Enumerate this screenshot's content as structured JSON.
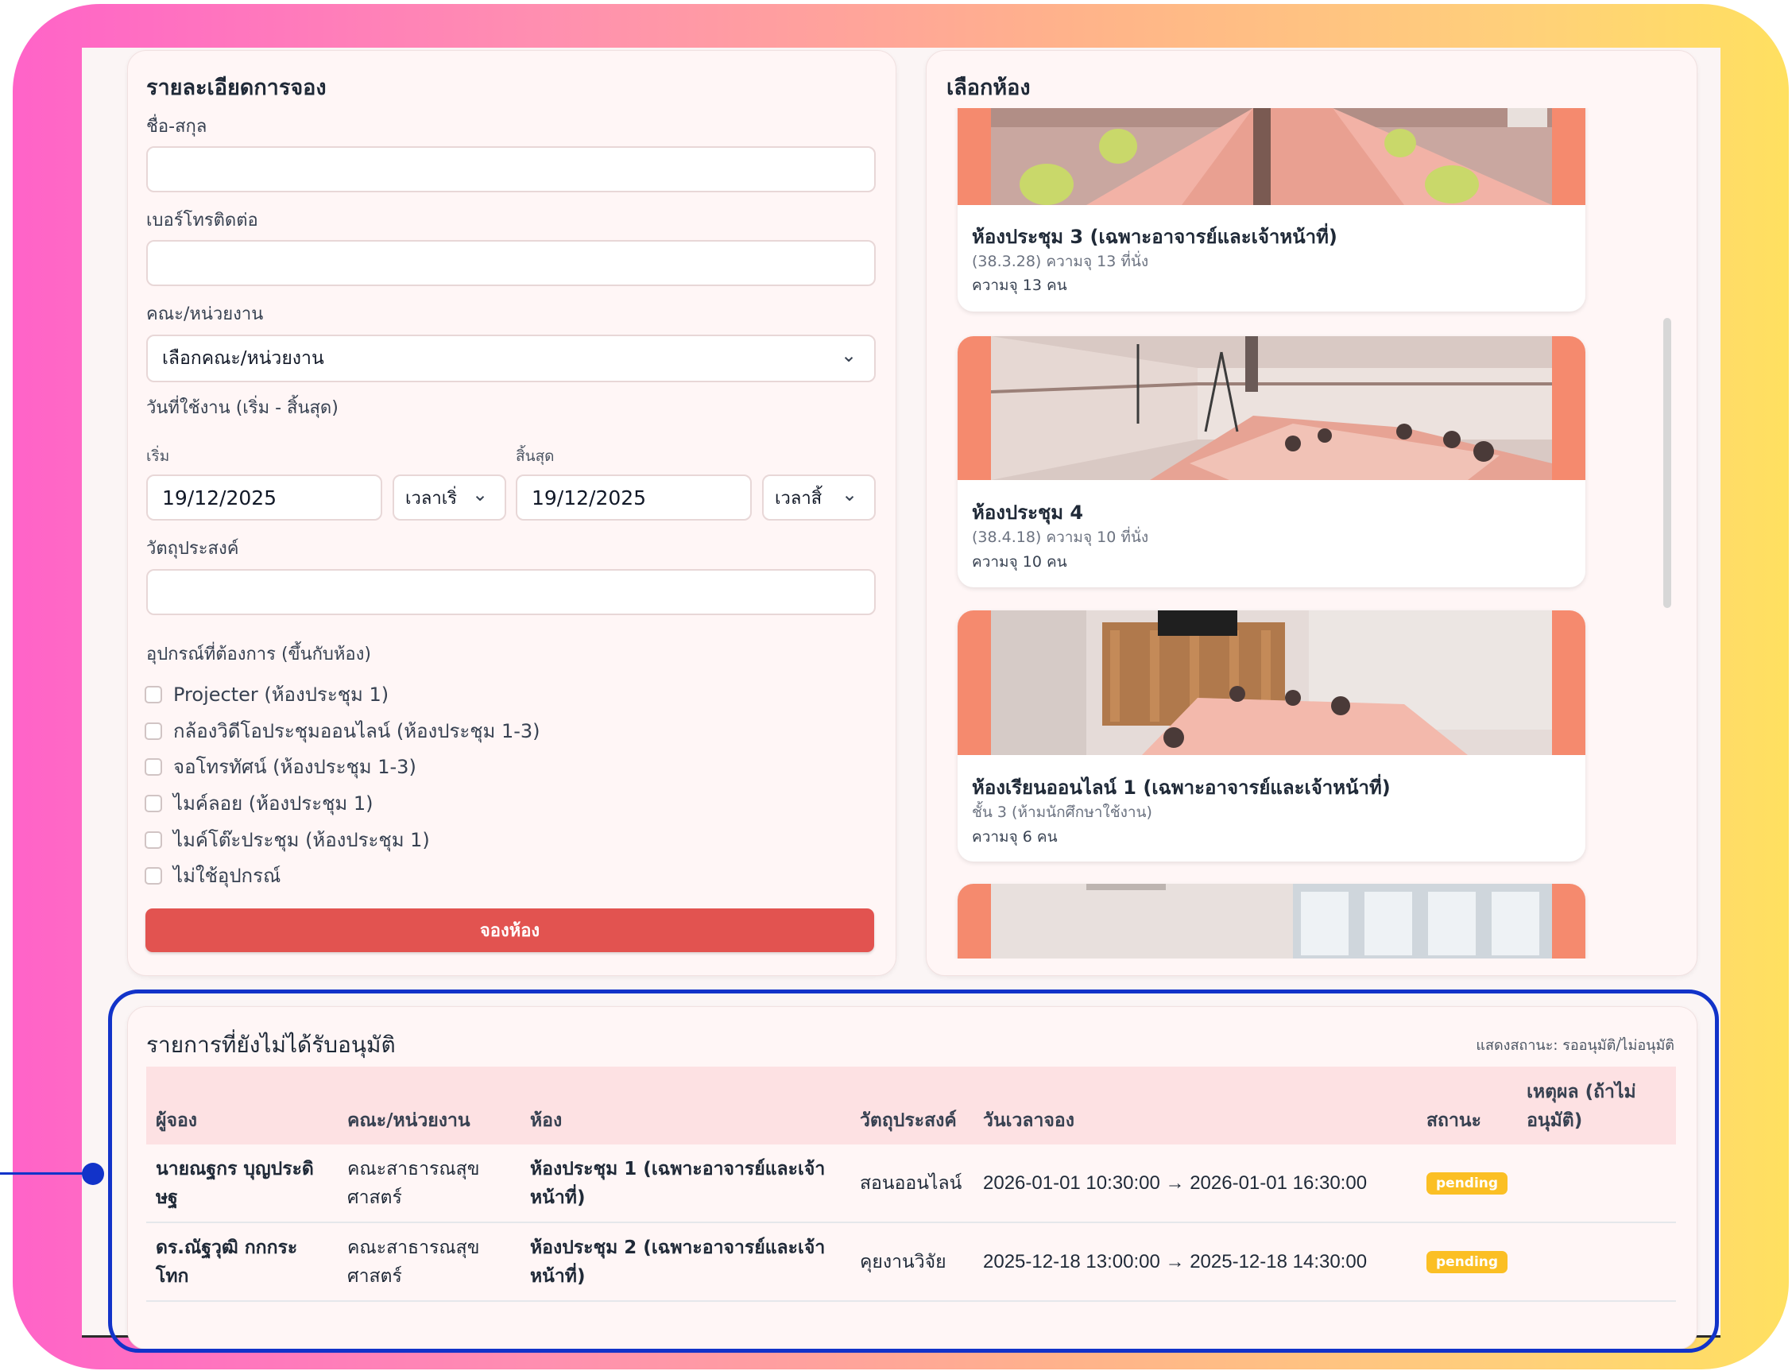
{
  "booking_form": {
    "title": "รายละเอียดการจอง",
    "name_label": "ชื่อ-สกุล",
    "name_value": "",
    "phone_label": "เบอร์โทรติดต่อ",
    "phone_value": "",
    "faculty_label": "คณะ/หน่วยงาน",
    "faculty_selected": "เลือกคณะ/หน่วยงาน",
    "date_range_label": "วันที่ใช้งาน (เริ่ม - สิ้นสุด)",
    "start_label": "เริ่ม",
    "start_date": "19/12/2025",
    "start_time": "เวลาเริ่",
    "end_label": "สิ้นสุด",
    "end_date": "19/12/2025",
    "end_time": "เวลาสิ้",
    "purpose_label": "วัตถุประสงค์",
    "purpose_value": "",
    "equipment_label": "อุปกรณ์ที่ต้องการ (ขึ้นกับห้อง)",
    "equipment": [
      "Projecter (ห้องประชุม 1)",
      "กล้องวิดีโอประชุมออนไลน์ (ห้องประชุม 1-3)",
      "จอโทรทัศน์ (ห้องประชุม 1-3)",
      "ไมค์ลอย (ห้องประชุม 1)",
      "ไมค์โต๊ะประชุม (ห้องประชุม 1)",
      "ไม่ใช้อุปกรณ์"
    ],
    "submit_label": "จองห้อง"
  },
  "room_picker": {
    "title": "เลือกห้อง",
    "rooms": [
      {
        "name": "ห้องประชุม 3 (เฉพาะอาจารย์และเจ้าหน้าที่)",
        "sub": "(38.3.28) ความจุ 13 ที่นั่ง",
        "capacity": "ความจุ 13 คน"
      },
      {
        "name": "ห้องประชุม 4",
        "sub": "(38.4.18) ความจุ 10 ที่นั่ง",
        "capacity": "ความจุ 10 คน"
      },
      {
        "name": "ห้องเรียนออนไลน์ 1 (เฉพาะอาจารย์และเจ้าหน้าที่)",
        "sub": "ชั้น 3 (ห้ามนักศึกษาใช้งาน)",
        "capacity": "ความจุ 6 คน"
      }
    ]
  },
  "pending": {
    "title": "รายการที่ยังไม่ได้รับอนุมัติ",
    "status_note": "แสดงสถานะ: รออนุมัติ/ไม่อนุมัติ",
    "columns": {
      "booker": "ผู้จอง",
      "faculty": "คณะ/หน่วยงาน",
      "room": "ห้อง",
      "purpose": "วัตถุประสงค์",
      "datetime": "วันเวลาจอง",
      "status": "สถานะ",
      "reason": "เหตุผล (ถ้าไม่อนุมัติ)"
    },
    "rows": [
      {
        "booker": "นายณฐกร บุญประดิษฐ",
        "faculty": "คณะสาธารณสุขศาสตร์",
        "room": "ห้องประชุม 1 (เฉพาะอาจารย์และเจ้าหน้าที่)",
        "purpose": "สอนออนไลน์",
        "datetime": "2026-01-01 10:30:00 → 2026-01-01 16:30:00",
        "status": "pending",
        "reason": ""
      },
      {
        "booker": "ดร.ณัฐวุฒิ กกกระโทก",
        "faculty": "คณะสาธารณสุขศาสตร์",
        "room": "ห้องประชุม 2 (เฉพาะอาจารย์และเจ้าหน้าที่)",
        "purpose": "คุยงานวิจัย",
        "datetime": "2025-12-18 13:00:00 → 2025-12-18 14:30:00",
        "status": "pending",
        "reason": ""
      }
    ]
  },
  "colors": {
    "accent": "#e25350",
    "badge": "#fbbf24",
    "header_row": "#fde1e3",
    "highlight": "#1233c9"
  },
  "icons": {
    "select_arrow": "chevron-down-icon"
  }
}
